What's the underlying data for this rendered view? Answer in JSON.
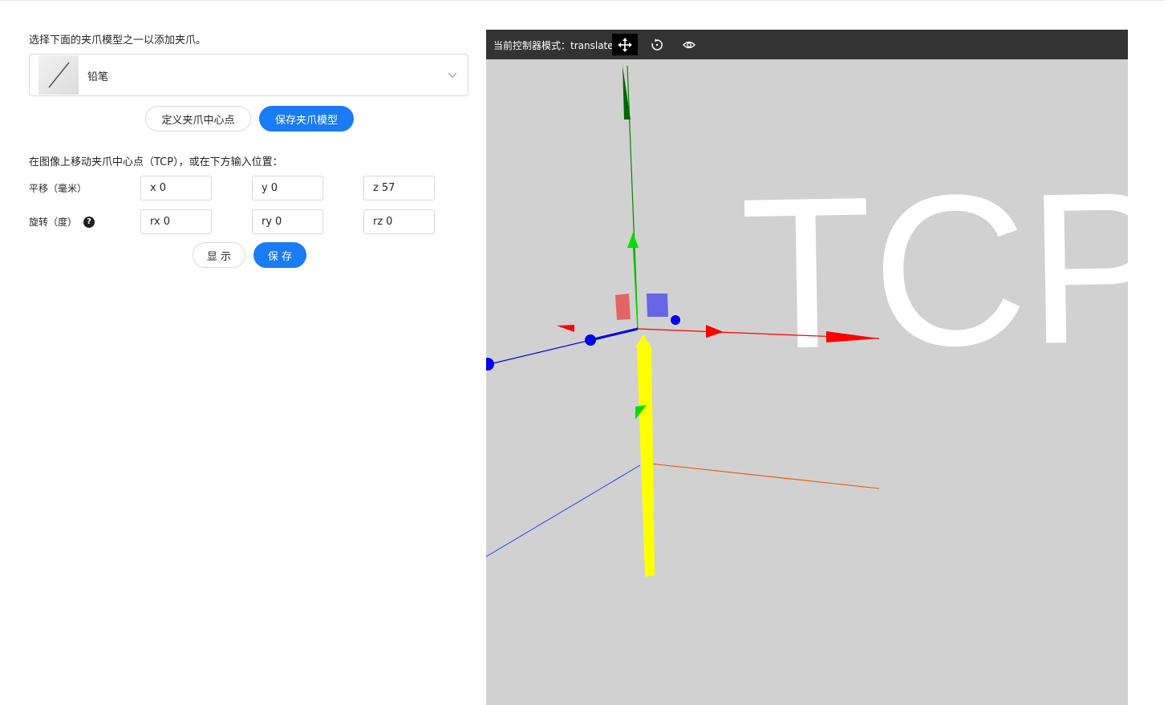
{
  "instruction": "选择下面的夹爪模型之一以添加夹爪。",
  "gripper_select": {
    "selected_label": "铅笔"
  },
  "buttons": {
    "define_center": "定义夹爪中心点",
    "save_model": "保存夹爪模型",
    "show": "显 示",
    "save": "保 存"
  },
  "tcp_instruction": "在图像上移动夹爪中心点（TCP），或在下方输入位置：",
  "translation": {
    "label": "平移（毫米）",
    "fields": [
      {
        "prefix": "x",
        "value": "0"
      },
      {
        "prefix": "y",
        "value": "0"
      },
      {
        "prefix": "z",
        "value": "57"
      }
    ]
  },
  "rotation": {
    "label": "旋转（度）",
    "help": "?",
    "fields": [
      {
        "prefix": "rx",
        "value": "0"
      },
      {
        "prefix": "ry",
        "value": "0"
      },
      {
        "prefix": "rz",
        "value": "0"
      }
    ]
  },
  "viewer": {
    "mode_label": "当前控制器模式：",
    "mode_value": "translate",
    "tcp_text": "TCP",
    "colors": {
      "background": "#d1d1d1",
      "toolbar": "#333333",
      "x_axis": "#ff0000",
      "y_axis": "#00cc00",
      "z_axis": "#0000ff",
      "pencil": "#ffff00",
      "primary": "#1a7cf5"
    },
    "tools": [
      "translate-icon",
      "rotate-icon",
      "eye-icon"
    ]
  }
}
